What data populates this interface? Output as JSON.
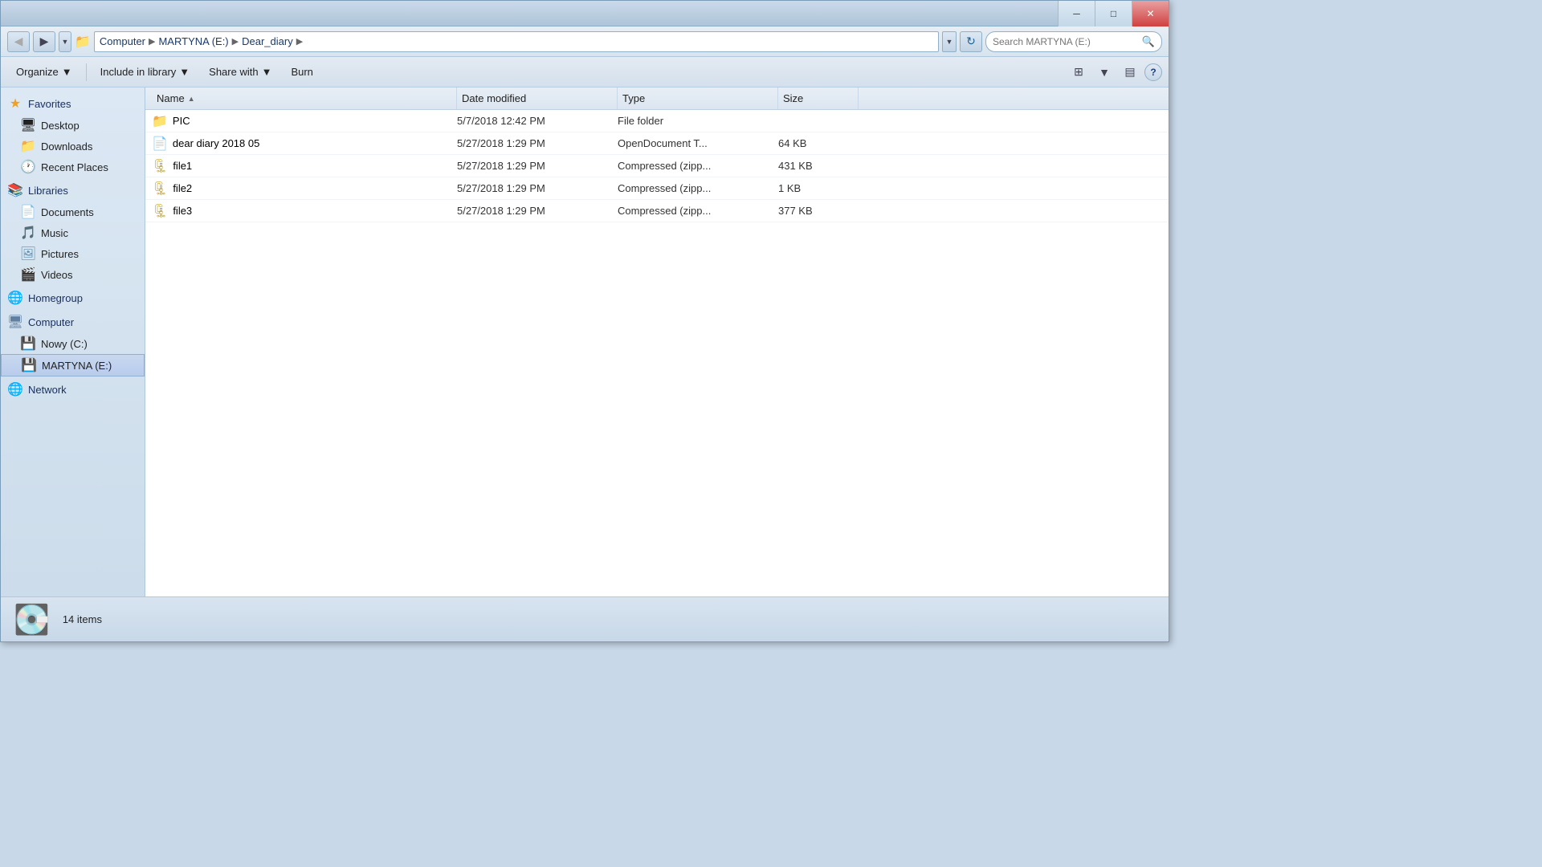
{
  "window": {
    "title": "Dear_diary"
  },
  "titlebar": {
    "minimize_label": "─",
    "maximize_label": "□",
    "close_label": "✕"
  },
  "addressbar": {
    "back_icon": "◀",
    "forward_icon": "▶",
    "dropdown_icon": "▼",
    "refresh_icon": "↻",
    "path_parts": [
      "Computer",
      "MARTYNA (E:)",
      "Dear_diary"
    ],
    "search_placeholder": "Search MARTYNA (E:)",
    "search_icon": "🔍"
  },
  "toolbar": {
    "organize_label": "Organize",
    "include_in_library_label": "Include in library",
    "share_with_label": "Share with",
    "burn_label": "Burn",
    "organize_arrow": "▼",
    "library_arrow": "▼",
    "share_arrow": "▼",
    "view_icon": "≡",
    "view_arrow": "▼",
    "layout_icon": "▤",
    "help_icon": "?"
  },
  "columns": {
    "name": "Name",
    "date_modified": "Date modified",
    "type": "Type",
    "size": "Size",
    "sort_arrow": "▲"
  },
  "files": [
    {
      "name": "PIC",
      "date": "5/7/2018 12:42 PM",
      "type": "File folder",
      "size": "",
      "icon": "📁",
      "icon_type": "folder"
    },
    {
      "name": "dear diary 2018 05",
      "date": "5/27/2018 1:29 PM",
      "type": "OpenDocument T...",
      "size": "64 KB",
      "icon": "📄",
      "icon_type": "doc"
    },
    {
      "name": "file1",
      "date": "5/27/2018 1:29 PM",
      "type": "Compressed (zipp...",
      "size": "431 KB",
      "icon": "🗜",
      "icon_type": "zip"
    },
    {
      "name": "file2",
      "date": "5/27/2018 1:29 PM",
      "type": "Compressed (zipp...",
      "size": "1 KB",
      "icon": "🗜",
      "icon_type": "zip"
    },
    {
      "name": "file3",
      "date": "5/27/2018 1:29 PM",
      "type": "Compressed (zipp...",
      "size": "377 KB",
      "icon": "🗜",
      "icon_type": "zip"
    }
  ],
  "sidebar": {
    "favorites_label": "Favorites",
    "desktop_label": "Desktop",
    "downloads_label": "Downloads",
    "recent_places_label": "Recent Places",
    "libraries_label": "Libraries",
    "documents_label": "Documents",
    "music_label": "Music",
    "pictures_label": "Pictures",
    "videos_label": "Videos",
    "homegroup_label": "Homegroup",
    "computer_label": "Computer",
    "nowy_label": "Nowy (C:)",
    "martyna_label": "MARTYNA (E:)",
    "network_label": "Network"
  },
  "statusbar": {
    "item_count": "14 items",
    "drive_icon": "💽"
  }
}
